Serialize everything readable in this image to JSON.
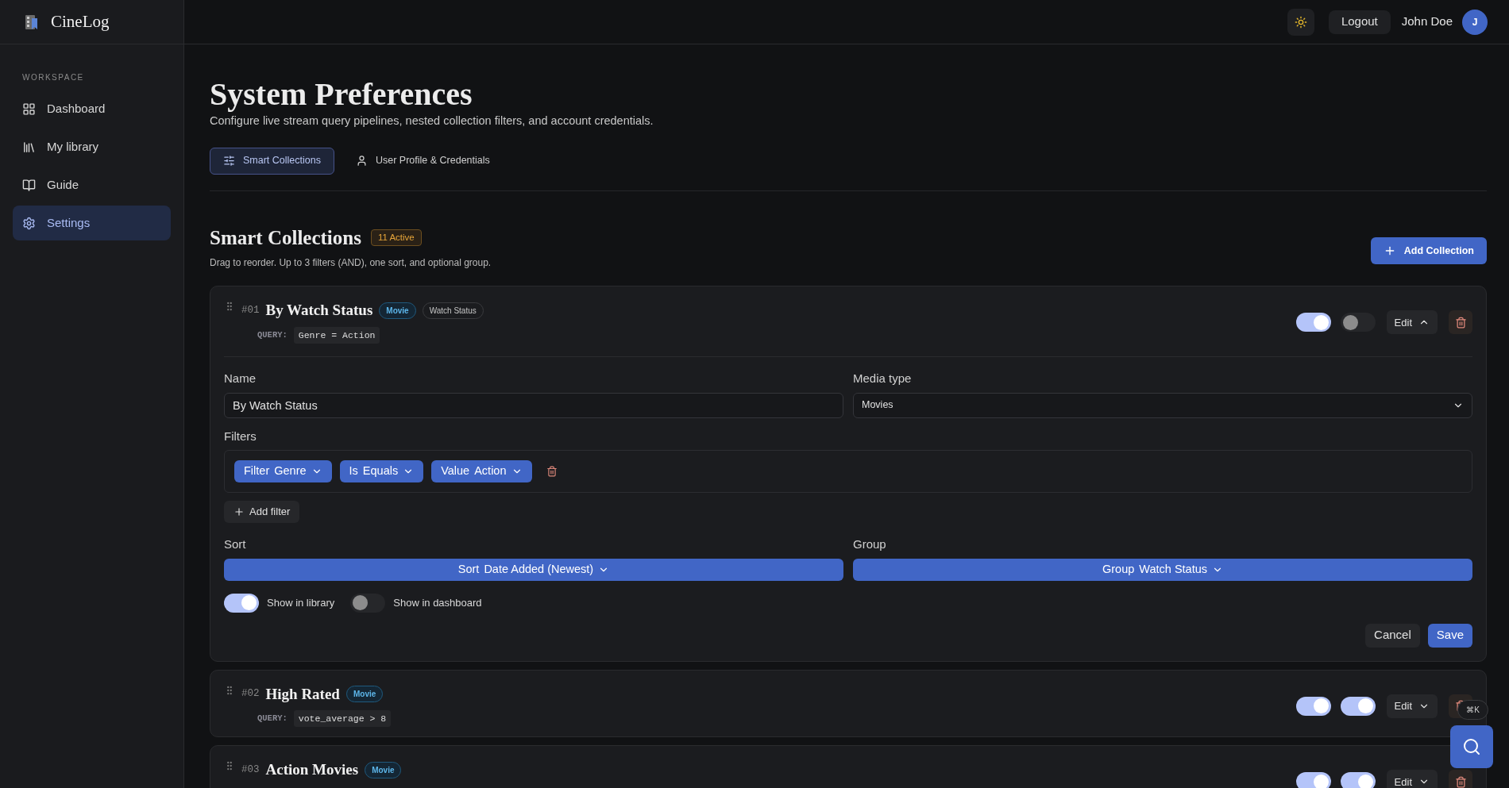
{
  "app": {
    "name": "CineLog"
  },
  "sidebar": {
    "section": "WORKSPACE",
    "items": [
      {
        "label": "Dashboard",
        "selected": false
      },
      {
        "label": "My library",
        "selected": false
      },
      {
        "label": "Guide",
        "selected": false
      },
      {
        "label": "Settings",
        "selected": true
      }
    ]
  },
  "header": {
    "logout": "Logout",
    "user": {
      "name": "John Doe",
      "initial": "J"
    }
  },
  "page": {
    "title": "System Preferences",
    "subtitle": "Configure live stream query pipelines, nested collection filters, and account credentials."
  },
  "tabs": [
    {
      "label": "Smart Collections",
      "selected": true
    },
    {
      "label": "User Profile & Credentials",
      "selected": false
    }
  ],
  "section": {
    "title": "Smart Collections",
    "badge": "11 Active",
    "hint": "Drag to reorder. Up to 3 filters (AND), one sort, and optional group.",
    "add_button": "Add Collection"
  },
  "collections": [
    {
      "number": "#01",
      "name": "By Watch Status",
      "tags": [
        {
          "label": "Movie",
          "kind": "media"
        },
        {
          "label": "Watch Status",
          "kind": "group"
        }
      ],
      "query_label": "QUERY:",
      "query": "Genre = Action",
      "library_on": true,
      "dashboard_on": false,
      "edit": "Edit",
      "expanded": true
    },
    {
      "number": "#02",
      "name": "High Rated",
      "tags": [
        {
          "label": "Movie",
          "kind": "media"
        }
      ],
      "query_label": "QUERY:",
      "query": "vote_average > 8",
      "library_on": true,
      "dashboard_on": true,
      "edit": "Edit",
      "expanded": false
    },
    {
      "number": "#03",
      "name": "Action Movies",
      "tags": [
        {
          "label": "Movie",
          "kind": "media"
        }
      ],
      "library_on": true,
      "dashboard_on": true,
      "edit": "Edit",
      "expanded": false
    }
  ],
  "editor": {
    "name_label": "Name",
    "name_value": "By Watch Status",
    "media_label": "Media type",
    "media_value": "Movies",
    "filters_label": "Filters",
    "filters": [
      {
        "label": "Filter",
        "value": "Genre"
      },
      {
        "label": "Is",
        "value": "Equals"
      },
      {
        "label": "Value",
        "value": "Action"
      }
    ],
    "add_filter": "Add filter",
    "sort_label": "Sort",
    "sort": {
      "label": "Sort",
      "value": "Date Added (Newest)"
    },
    "group_label": "Group",
    "group": {
      "label": "Group",
      "value": "Watch Status"
    },
    "toggles": [
      {
        "label": "Show in library",
        "on": true
      },
      {
        "label": "Show in dashboard",
        "on": false
      }
    ],
    "cancel": "Cancel",
    "save": "Save"
  },
  "search_shortcut": "⌘K"
}
